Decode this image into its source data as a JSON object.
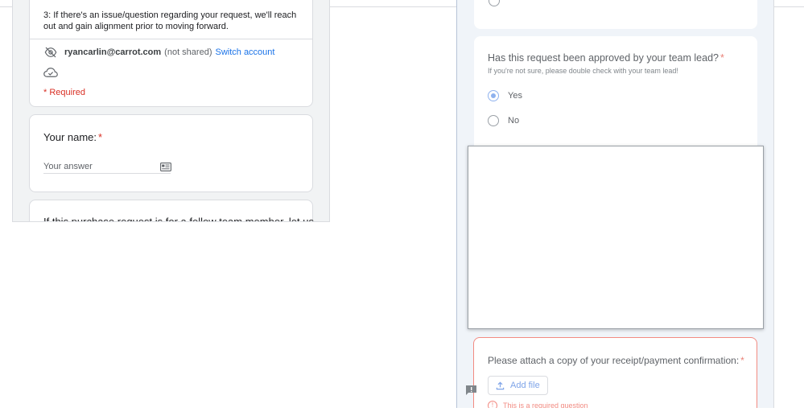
{
  "left_form": {
    "intro_text": "3: If there's an issue/question regarding your request, we'll reach out and gain alignment prior to moving forward.",
    "account": {
      "email": "ryancarlin@carrot.com",
      "shared_note": "(not shared)",
      "switch_label": "Switch account"
    },
    "required_note": "* Required",
    "name_question": {
      "label": "Your name:",
      "required_star": "*",
      "placeholder": "Your answer"
    },
    "next_question_partial": "If this purchase request is for a fellow team member, let us"
  },
  "right_form": {
    "approval_question": {
      "title": "Has this request been approved by your team lead?",
      "required_star": "*",
      "help_text": "If you're not sure, please double check with your team lead!",
      "options": [
        {
          "label": "Yes",
          "selected": true
        },
        {
          "label": "No",
          "selected": false
        }
      ]
    },
    "attach_question": {
      "title": "Please attach a copy of your receipt/payment confirmation:",
      "required_star": "*",
      "add_file_label": "Add file",
      "error_text": "This is a required question"
    }
  },
  "icons": [
    "eye-off-icon",
    "cloud-icon",
    "autofill-card-icon",
    "upload-icon",
    "error-icon",
    "report-feedback-icon"
  ],
  "colors": {
    "accent_blue": "#1a73e8",
    "required_red": "#d93025",
    "error_border": "#f28b82",
    "panel_bg": "#f0f4f9"
  }
}
